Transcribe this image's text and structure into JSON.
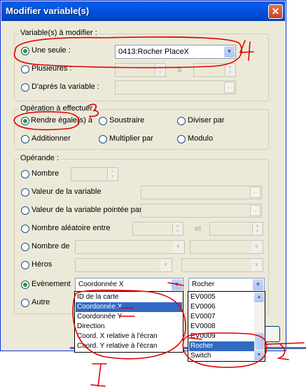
{
  "window": {
    "title": "Modifier variable(s)",
    "close_glyph": "✕"
  },
  "group_variables": {
    "legend": "Variable(s) à modifier :",
    "single": {
      "label": "Une seule :",
      "value": "0413:Rocher PlaceX",
      "selected": true
    },
    "multiple": {
      "label": "Plusieures :",
      "range_sep": "à"
    },
    "by_variable": {
      "label": "D'après la variable :",
      "browse": "..."
    }
  },
  "group_operation": {
    "legend": "Opération à effectuer :",
    "options": [
      "Rendre égale(s) à",
      "Soustraire",
      "Diviser par",
      "Additionner",
      "Multiplier par",
      "Modulo"
    ],
    "selected": "Rendre égale(s) à"
  },
  "group_operand": {
    "legend": "Opérande :",
    "number": {
      "label": "Nombre"
    },
    "var_value": {
      "label": "Valeur de la variable",
      "browse": "..."
    },
    "var_pointed": {
      "label": "Valeur de la variable pointée par",
      "browse": "..."
    },
    "random": {
      "label": "Nombre aléatoire entre",
      "sep": "et",
      "browse": "..."
    },
    "item_count": {
      "label": "Nombre de"
    },
    "hero": {
      "label": "Héros"
    },
    "event": {
      "label": "Evènement",
      "attribute": "Coordonnée X",
      "target": "Rocher",
      "selected": true
    },
    "other": {
      "label": "Autre"
    }
  },
  "attribute_dropdown": {
    "items": [
      "ID de la carte",
      "Coordonnée X",
      "Coordonnée Y",
      "Direction",
      "Coord. X relative à l'écran",
      "Coord. Y relative à l'écran"
    ],
    "selected": "Coordonnée X"
  },
  "event_dropdown": {
    "items": [
      "EV0005",
      "EV0006",
      "EV0007",
      "EV0008",
      "EV0009",
      "Rocher",
      "Switch"
    ],
    "selected": "Rocher"
  },
  "annotations": {
    "mark_4": "4",
    "mark_3": "3",
    "mark_1": "1",
    "mark_2": "2",
    "color": "#e00000"
  }
}
